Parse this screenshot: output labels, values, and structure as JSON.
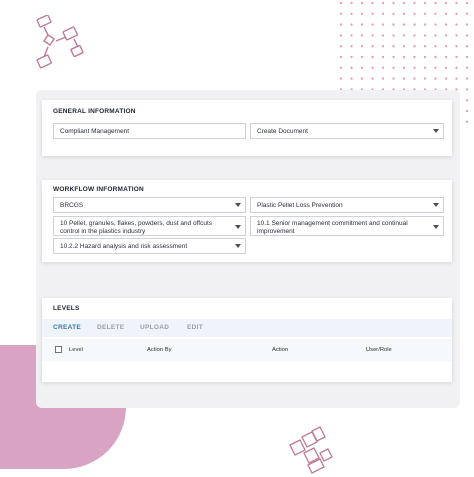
{
  "general": {
    "title": "GENERAL INFORMATION",
    "compliant": "Compliant Management",
    "action": "Create Document"
  },
  "workflow": {
    "title": "WORKFLOW INFORMATION",
    "standard": "BRCGS",
    "program": "Plastic Pellet Loss Prevention",
    "section": "10 Pellet, granules, flakes, powders, dust and offcuts control in the plastics industry",
    "clause": "10.1 Senior management commitment and continual improvement",
    "subclause": "10.2.2 Hazard analysis and risk assessment"
  },
  "levels": {
    "title": "LEVELS",
    "tabs": [
      "CREATE",
      "DELETE",
      "UPLOAD",
      "EDIT"
    ],
    "columns": [
      "Level",
      "Action By",
      "Action",
      "User/Role"
    ]
  },
  "colors": {
    "accent": "#3b76a5",
    "decor_pink": "#d9a4c3"
  }
}
